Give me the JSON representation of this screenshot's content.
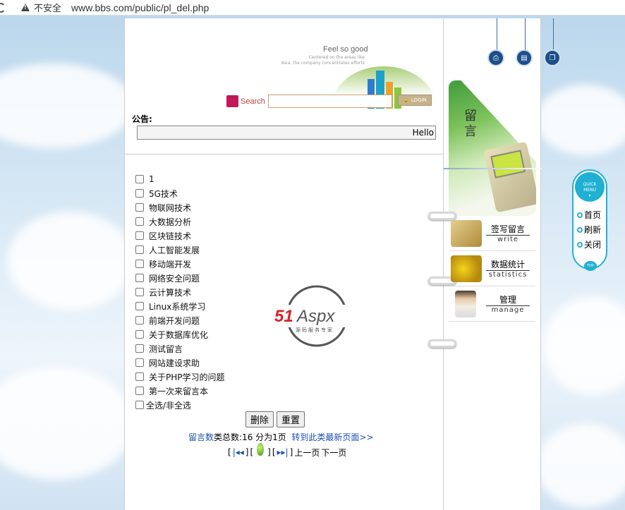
{
  "browser": {
    "security_label": "不安全",
    "url": "www.bbs.com/public/pl_del.php"
  },
  "header": {
    "slogan": "Feel so good",
    "slogan_sub_1": "Centered on the areas like",
    "slogan_sub_2": "Asia, the company concentrates efforts"
  },
  "search": {
    "label": "Search",
    "value": "",
    "login_label": "LOGIN"
  },
  "notice": {
    "label": "公告:",
    "marquee_text": "Hello"
  },
  "list": {
    "items": [
      "1",
      "5G技术",
      "物联网技术",
      "大数据分析",
      "区块链技术",
      "人工智能发展",
      "移动端开发",
      "网络安全问题",
      "云计算技术",
      "Linux系统学习",
      "前端开发问题",
      "关于数据库优化",
      "测试留言",
      "网站建设求助",
      "关于PHP学习的问题",
      "第一次来留言本"
    ],
    "select_all_label": "全选/非全选"
  },
  "watermark": {
    "brand_red": "51",
    "brand_rest": "Aspx",
    "tagline": "源码服务专家"
  },
  "actions": {
    "delete_label": "删除",
    "reset_label": "重置"
  },
  "stats": {
    "link_label": "留言数",
    "text": "类总数:16  分为1页",
    "latest_link": "转到此类最新页面>>"
  },
  "pager": {
    "first": "|◂◂",
    "last": "▸▸|",
    "prev": "上一页",
    "next": "下一页"
  },
  "sidebar": {
    "banner_text": "留言",
    "items": [
      {
        "cn": "签写留言",
        "en": "write"
      },
      {
        "cn": "数据统计",
        "en": "statistics"
      },
      {
        "cn": "管理",
        "en": "manage"
      }
    ]
  },
  "quick_menu": {
    "title_1": "QUICK",
    "title_2": "MENU",
    "items": [
      "首页",
      "刷新",
      "关闭"
    ],
    "top_label": "TOP"
  },
  "colors": {
    "link_blue": "#1a52b0",
    "quick_cyan": "#21b2d4",
    "brand_red": "#d8232a",
    "brand_green": "#2e8b3a"
  }
}
